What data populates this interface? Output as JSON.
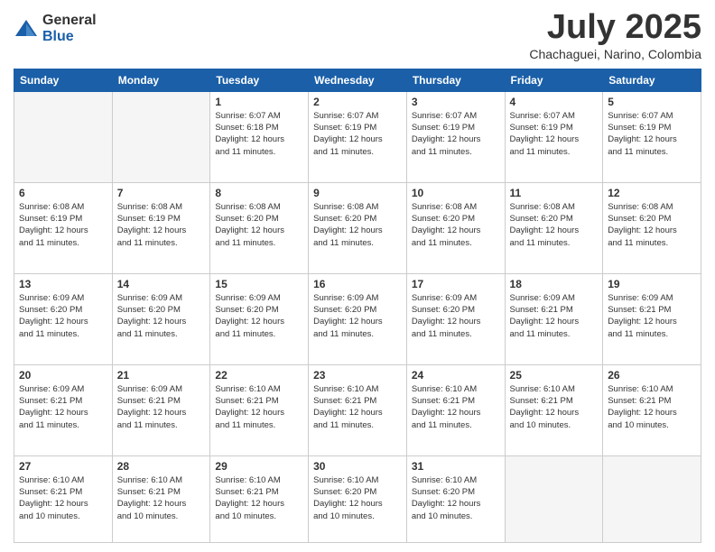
{
  "logo": {
    "general": "General",
    "blue": "Blue"
  },
  "header": {
    "month_year": "July 2025",
    "location": "Chachaguei, Narino, Colombia"
  },
  "weekdays": [
    "Sunday",
    "Monday",
    "Tuesday",
    "Wednesday",
    "Thursday",
    "Friday",
    "Saturday"
  ],
  "weeks": [
    [
      {
        "day": "",
        "info": ""
      },
      {
        "day": "",
        "info": ""
      },
      {
        "day": "1",
        "info": "Sunrise: 6:07 AM\nSunset: 6:18 PM\nDaylight: 12 hours\nand 11 minutes."
      },
      {
        "day": "2",
        "info": "Sunrise: 6:07 AM\nSunset: 6:19 PM\nDaylight: 12 hours\nand 11 minutes."
      },
      {
        "day": "3",
        "info": "Sunrise: 6:07 AM\nSunset: 6:19 PM\nDaylight: 12 hours\nand 11 minutes."
      },
      {
        "day": "4",
        "info": "Sunrise: 6:07 AM\nSunset: 6:19 PM\nDaylight: 12 hours\nand 11 minutes."
      },
      {
        "day": "5",
        "info": "Sunrise: 6:07 AM\nSunset: 6:19 PM\nDaylight: 12 hours\nand 11 minutes."
      }
    ],
    [
      {
        "day": "6",
        "info": "Sunrise: 6:08 AM\nSunset: 6:19 PM\nDaylight: 12 hours\nand 11 minutes."
      },
      {
        "day": "7",
        "info": "Sunrise: 6:08 AM\nSunset: 6:19 PM\nDaylight: 12 hours\nand 11 minutes."
      },
      {
        "day": "8",
        "info": "Sunrise: 6:08 AM\nSunset: 6:20 PM\nDaylight: 12 hours\nand 11 minutes."
      },
      {
        "day": "9",
        "info": "Sunrise: 6:08 AM\nSunset: 6:20 PM\nDaylight: 12 hours\nand 11 minutes."
      },
      {
        "day": "10",
        "info": "Sunrise: 6:08 AM\nSunset: 6:20 PM\nDaylight: 12 hours\nand 11 minutes."
      },
      {
        "day": "11",
        "info": "Sunrise: 6:08 AM\nSunset: 6:20 PM\nDaylight: 12 hours\nand 11 minutes."
      },
      {
        "day": "12",
        "info": "Sunrise: 6:08 AM\nSunset: 6:20 PM\nDaylight: 12 hours\nand 11 minutes."
      }
    ],
    [
      {
        "day": "13",
        "info": "Sunrise: 6:09 AM\nSunset: 6:20 PM\nDaylight: 12 hours\nand 11 minutes."
      },
      {
        "day": "14",
        "info": "Sunrise: 6:09 AM\nSunset: 6:20 PM\nDaylight: 12 hours\nand 11 minutes."
      },
      {
        "day": "15",
        "info": "Sunrise: 6:09 AM\nSunset: 6:20 PM\nDaylight: 12 hours\nand 11 minutes."
      },
      {
        "day": "16",
        "info": "Sunrise: 6:09 AM\nSunset: 6:20 PM\nDaylight: 12 hours\nand 11 minutes."
      },
      {
        "day": "17",
        "info": "Sunrise: 6:09 AM\nSunset: 6:20 PM\nDaylight: 12 hours\nand 11 minutes."
      },
      {
        "day": "18",
        "info": "Sunrise: 6:09 AM\nSunset: 6:21 PM\nDaylight: 12 hours\nand 11 minutes."
      },
      {
        "day": "19",
        "info": "Sunrise: 6:09 AM\nSunset: 6:21 PM\nDaylight: 12 hours\nand 11 minutes."
      }
    ],
    [
      {
        "day": "20",
        "info": "Sunrise: 6:09 AM\nSunset: 6:21 PM\nDaylight: 12 hours\nand 11 minutes."
      },
      {
        "day": "21",
        "info": "Sunrise: 6:09 AM\nSunset: 6:21 PM\nDaylight: 12 hours\nand 11 minutes."
      },
      {
        "day": "22",
        "info": "Sunrise: 6:10 AM\nSunset: 6:21 PM\nDaylight: 12 hours\nand 11 minutes."
      },
      {
        "day": "23",
        "info": "Sunrise: 6:10 AM\nSunset: 6:21 PM\nDaylight: 12 hours\nand 11 minutes."
      },
      {
        "day": "24",
        "info": "Sunrise: 6:10 AM\nSunset: 6:21 PM\nDaylight: 12 hours\nand 11 minutes."
      },
      {
        "day": "25",
        "info": "Sunrise: 6:10 AM\nSunset: 6:21 PM\nDaylight: 12 hours\nand 10 minutes."
      },
      {
        "day": "26",
        "info": "Sunrise: 6:10 AM\nSunset: 6:21 PM\nDaylight: 12 hours\nand 10 minutes."
      }
    ],
    [
      {
        "day": "27",
        "info": "Sunrise: 6:10 AM\nSunset: 6:21 PM\nDaylight: 12 hours\nand 10 minutes."
      },
      {
        "day": "28",
        "info": "Sunrise: 6:10 AM\nSunset: 6:21 PM\nDaylight: 12 hours\nand 10 minutes."
      },
      {
        "day": "29",
        "info": "Sunrise: 6:10 AM\nSunset: 6:21 PM\nDaylight: 12 hours\nand 10 minutes."
      },
      {
        "day": "30",
        "info": "Sunrise: 6:10 AM\nSunset: 6:20 PM\nDaylight: 12 hours\nand 10 minutes."
      },
      {
        "day": "31",
        "info": "Sunrise: 6:10 AM\nSunset: 6:20 PM\nDaylight: 12 hours\nand 10 minutes."
      },
      {
        "day": "",
        "info": ""
      },
      {
        "day": "",
        "info": ""
      }
    ]
  ]
}
